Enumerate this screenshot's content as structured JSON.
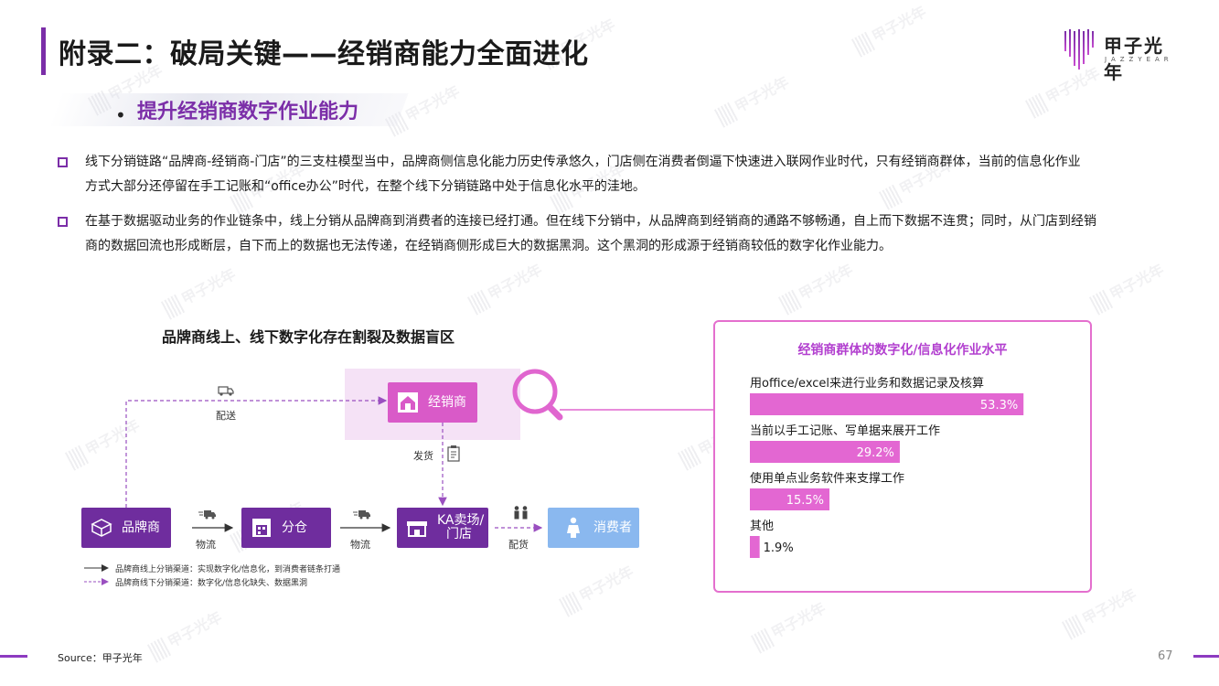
{
  "header": {
    "title": "附录二：破局关键——经销商能力全面进化",
    "logo_cn": "甲子光年",
    "logo_en": "JAZZYEAR"
  },
  "section": {
    "subtitle": "提升经销商数字作业能力"
  },
  "paragraphs": [
    {
      "line1": "线下分销链路“品牌商-经销商-门店”的三支柱模型当中，品牌商侧信息化能力历史传承悠久，门店侧在消费者倒逼下快速进入联网作业时代，只有经销商群体，当前的信息化作业",
      "line2": "方式大部分还停留在手工记账和“office办公”时代，在整个线下分销链路中处于信息化水平的洼地。"
    },
    {
      "line1": "在基于数据驱动业务的作业链条中，线上分销从品牌商到消费者的连接已经打通。但在线下分销中，从品牌商到经销商的通路不够畅通，自上而下数据不连贯；同时，从门店到经销",
      "line2": "商的数据回流也形成断层，自下而上的数据也无法传递，在经销商侧形成巨大的数据黑洞。这个黑洞的形成源于经销商较低的数字化作业能力。"
    }
  ],
  "diagram": {
    "title": "品牌商线上、线下数字化存在割裂及数据盲区",
    "nodes": {
      "brand": "品牌商",
      "fencang": "分仓",
      "ka": "KA卖场/\n门店",
      "ka_line1": "KA卖场/",
      "ka_line2": "门店",
      "consumer": "消费者",
      "dealer": "经销商"
    },
    "edge_labels": {
      "peisong": "配送",
      "fahuo": "发货",
      "wuliu1": "物流",
      "wuliu2": "物流",
      "peihuo": "配货"
    },
    "legend": {
      "online": "品牌商线上分销渠道：实现数字化/信息化，到消费者链条打通",
      "offline": "品牌商线下分销渠道：数字化/信息化缺失、数据黑洞"
    },
    "colors": {
      "purple": "#6f2d9e",
      "pink": "#d95ac8",
      "blue": "#8ab8ef"
    }
  },
  "chart_data": {
    "type": "bar",
    "title": "经销商群体的数字化/信息化作业水平",
    "categories": [
      "用office/excel来进行业务和数据记录及核算",
      "当前以手工记账、写单据来展开工作",
      "使用单点业务软件来支撑工作",
      "其他"
    ],
    "values": [
      53.3,
      29.2,
      15.5,
      1.9
    ],
    "value_labels": [
      "53.3%",
      "29.2%",
      "15.5%",
      "1.9%"
    ],
    "orientation": "horizontal",
    "bar_color": "#e367d2",
    "xlim": [
      0,
      57
    ]
  },
  "footer": {
    "source": "Source：甲子光年",
    "page": "67"
  },
  "watermark": "甲子光年"
}
